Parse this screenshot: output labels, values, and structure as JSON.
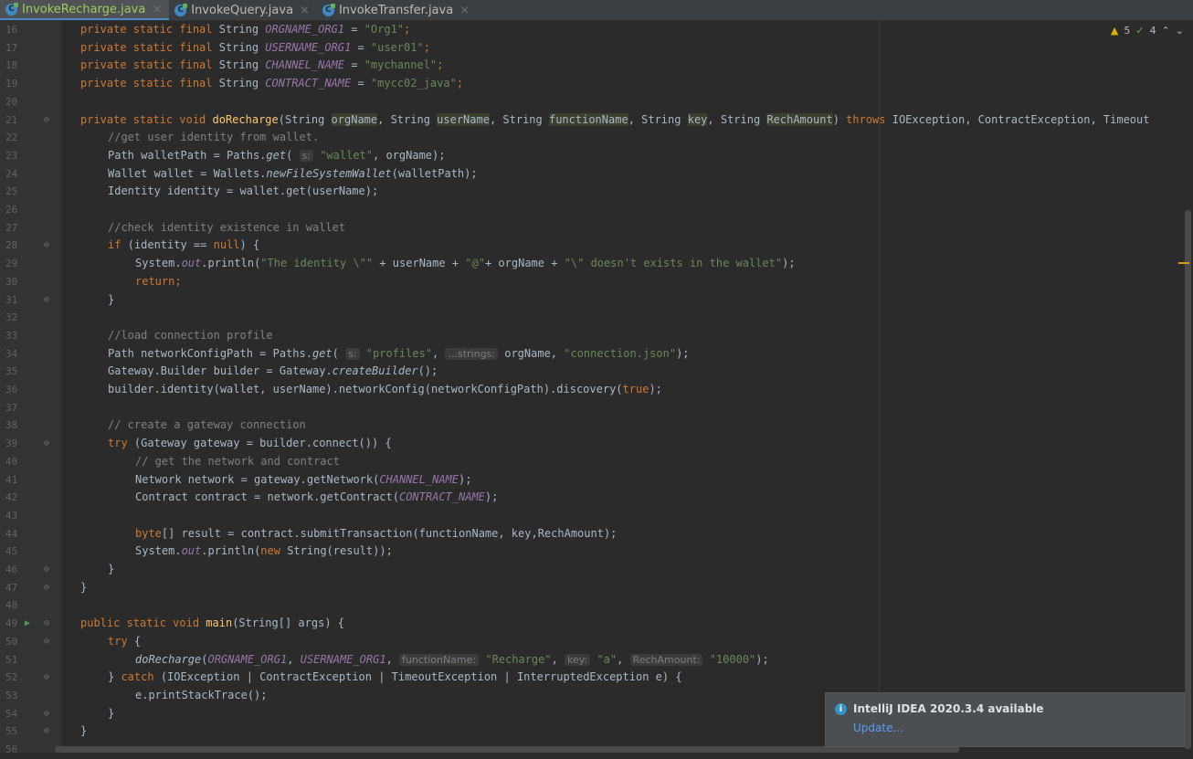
{
  "tabs": [
    {
      "label": "InvokeRecharge.java",
      "active": true
    },
    {
      "label": "InvokeQuery.java",
      "active": false
    },
    {
      "label": "InvokeTransfer.java",
      "active": false
    }
  ],
  "indicators": {
    "warnings": "5",
    "checks": "4"
  },
  "notification": {
    "title": "IntelliJ IDEA 2020.3.4 available",
    "link": "Update..."
  },
  "lines": {
    "n16": "16",
    "n17": "17",
    "n18": "18",
    "n19": "19",
    "n20": "20",
    "n21": "21",
    "n22": "22",
    "n23": "23",
    "n24": "24",
    "n25": "25",
    "n26": "26",
    "n27": "27",
    "n28": "28",
    "n29": "29",
    "n30": "30",
    "n31": "31",
    "n32": "32",
    "n33": "33",
    "n34": "34",
    "n35": "35",
    "n36": "36",
    "n37": "37",
    "n38": "38",
    "n39": "39",
    "n40": "40",
    "n41": "41",
    "n42": "42",
    "n43": "43",
    "n44": "44",
    "n45": "45",
    "n46": "46",
    "n47": "47",
    "n48": "48",
    "n49": "49",
    "n50": "50",
    "n51": "51",
    "n52": "52",
    "n53": "53",
    "n54": "54",
    "n55": "55",
    "n56": "56"
  },
  "code": {
    "l16": {
      "a": "private static final ",
      "b": "String ",
      "c": "ORGNAME_ORG1",
      "d": " = ",
      "e": "\"Org1\"",
      "f": ";"
    },
    "l17": {
      "a": "private static final ",
      "b": "String ",
      "c": "USERNAME_ORG1",
      "d": " = ",
      "e": "\"user01\"",
      "f": ";"
    },
    "l18": {
      "a": "private static final ",
      "b": "String ",
      "c": "CHANNEL_NAME",
      "d": " = ",
      "e": "\"mychannel\"",
      "f": ";"
    },
    "l19": {
      "a": "private static final ",
      "b": "String ",
      "c": "CONTRACT_NAME",
      "d": " = ",
      "e": "\"mycc02_java\"",
      "f": ";"
    },
    "l21": {
      "a": "private static void ",
      "b": "doRecharge",
      "c": "(String ",
      "d": "orgName",
      "e": ", String ",
      "f": "userName",
      "g": ", String ",
      "h": "functionName",
      "i": ", String ",
      "j": "key",
      "k": ", String ",
      "l": "RechAmount",
      "m": ") ",
      "n": "throws ",
      "o": "IOException, ContractException, Timeout"
    },
    "l22": {
      "a": "//get user identity from wallet."
    },
    "l23": {
      "a": "Path walletPath = Paths.",
      "b": "get",
      "c": "( ",
      "h": "s:",
      "d": " ",
      "e": "\"wallet\"",
      "f": ", orgName);"
    },
    "l24": {
      "a": "Wallet wallet = Wallets.",
      "b": "newFileSystemWallet",
      "c": "(walletPath);"
    },
    "l25": {
      "a": "Identity identity = wallet.get(userName);"
    },
    "l27": {
      "a": "//check identity existence in wallet"
    },
    "l28": {
      "a": "if ",
      "b": "(identity == ",
      "c": "null",
      "d": ") {"
    },
    "l29": {
      "a": "System.",
      "b": "out",
      "c": ".println(",
      "d": "\"The identity \\\"\"",
      "e": " + userName + ",
      "f": "\"@\"",
      "g": "+ orgName + ",
      "h": "\"\\\" doesn't exists in the wallet\"",
      "i": ");"
    },
    "l30": {
      "a": "return",
      "b": ";"
    },
    "l31": {
      "a": "}"
    },
    "l33": {
      "a": "//load connection profile"
    },
    "l34": {
      "a": "Path networkConfigPath = Paths.",
      "b": "get",
      "c": "( ",
      "h1": "s:",
      "d": " ",
      "e": "\"profiles\"",
      "f": ", ",
      "h2": "...strings:",
      "g": " orgName, ",
      "i": "\"connection.json\"",
      "j": ");"
    },
    "l35": {
      "a": "Gateway.Builder builder = Gateway.",
      "b": "createBuilder",
      "c": "();"
    },
    "l36": {
      "a": "builder.identity(wallet, userName).networkConfig(networkConfigPath).discovery(",
      "b": "true",
      "c": ");"
    },
    "l38": {
      "a": "// create a gateway connection"
    },
    "l39": {
      "a": "try ",
      "b": "(Gateway gateway = builder.connect()) {"
    },
    "l40": {
      "a": "// get the network and contract"
    },
    "l41": {
      "a": "Network network = gateway.getNetwork(",
      "b": "CHANNEL_NAME",
      "c": ");"
    },
    "l42": {
      "a": "Contract contract = network.getContract(",
      "b": "CONTRACT_NAME",
      "c": ");"
    },
    "l44": {
      "a": "byte",
      "b": "[] result = contract.submitTransaction(functionName, key,RechAmount);"
    },
    "l45": {
      "a": "System.",
      "b": "out",
      "c": ".println(",
      "d": "new ",
      "e": "String(result));"
    },
    "l46": {
      "a": "}"
    },
    "l47": {
      "a": "}"
    },
    "l49": {
      "a": "public static void ",
      "b": "main",
      "c": "(String[] args) {"
    },
    "l50": {
      "a": "try ",
      "b": "{"
    },
    "l51": {
      "a": "doRecharge",
      "b": "(",
      "c": "ORGNAME_ORG1",
      "d": ", ",
      "e": "USERNAME_ORG1",
      "f": ", ",
      "h1": "functionName:",
      "g": " ",
      "i": "\"Recharge\"",
      "j": ", ",
      "h2": "key:",
      "k": " ",
      "l": "\"a\"",
      "m": ", ",
      "h3": "RechAmount:",
      "n": " ",
      "o": "\"10000\"",
      "p": ");"
    },
    "l52": {
      "a": "} ",
      "b": "catch ",
      "c": "(IOException | ContractException | TimeoutException | InterruptedException e) {"
    },
    "l53": {
      "a": "e.printStackTrace();"
    },
    "l54": {
      "a": "}"
    },
    "l55": {
      "a": "}"
    }
  }
}
